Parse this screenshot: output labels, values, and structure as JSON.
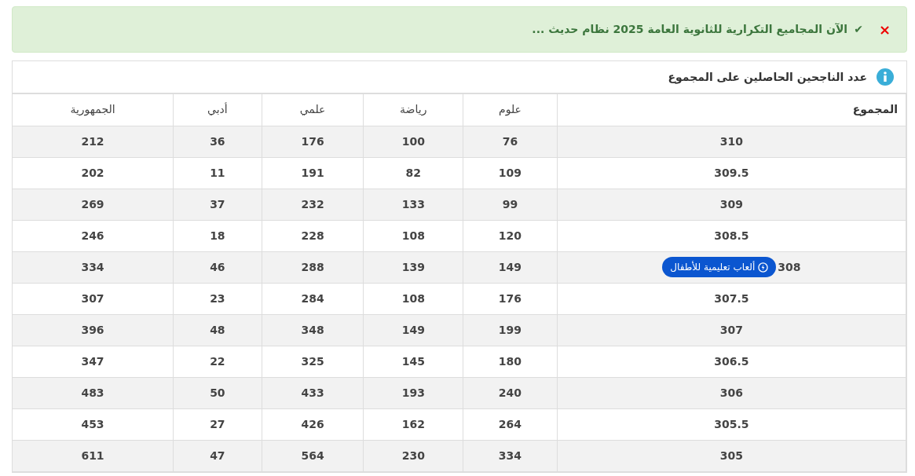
{
  "alert": {
    "close": "×",
    "check": "✔",
    "text": "الآن المجاميع التكرارية للثانوية العامة 2025 نظام حديث ..."
  },
  "panel": {
    "title": "عدد الناجحين الحاصلين على المجموع"
  },
  "table": {
    "columns": [
      "الجمهورية",
      "أدبي",
      "علمي",
      "رياضة",
      "علوم",
      "المجموع"
    ],
    "rows": [
      {
        "cells": [
          "212",
          "36",
          "176",
          "100",
          "76",
          "310"
        ]
      },
      {
        "cells": [
          "202",
          "11",
          "191",
          "82",
          "109",
          "309.5"
        ]
      },
      {
        "cells": [
          "269",
          "37",
          "232",
          "133",
          "99",
          "309"
        ]
      },
      {
        "cells": [
          "246",
          "18",
          "228",
          "108",
          "120",
          "308.5"
        ]
      },
      {
        "cells": [
          "334",
          "46",
          "288",
          "139",
          "149",
          "308"
        ],
        "badge": "ألعاب تعليمية للأطفال"
      },
      {
        "cells": [
          "307",
          "23",
          "284",
          "108",
          "176",
          "307.5"
        ]
      },
      {
        "cells": [
          "396",
          "48",
          "348",
          "149",
          "199",
          "307"
        ]
      },
      {
        "cells": [
          "347",
          "22",
          "325",
          "145",
          "180",
          "306.5"
        ]
      },
      {
        "cells": [
          "483",
          "50",
          "433",
          "193",
          "240",
          "306"
        ]
      },
      {
        "cells": [
          "453",
          "27",
          "426",
          "162",
          "264",
          "305.5"
        ]
      },
      {
        "cells": [
          "611",
          "47",
          "564",
          "230",
          "334",
          "305"
        ]
      }
    ]
  }
}
